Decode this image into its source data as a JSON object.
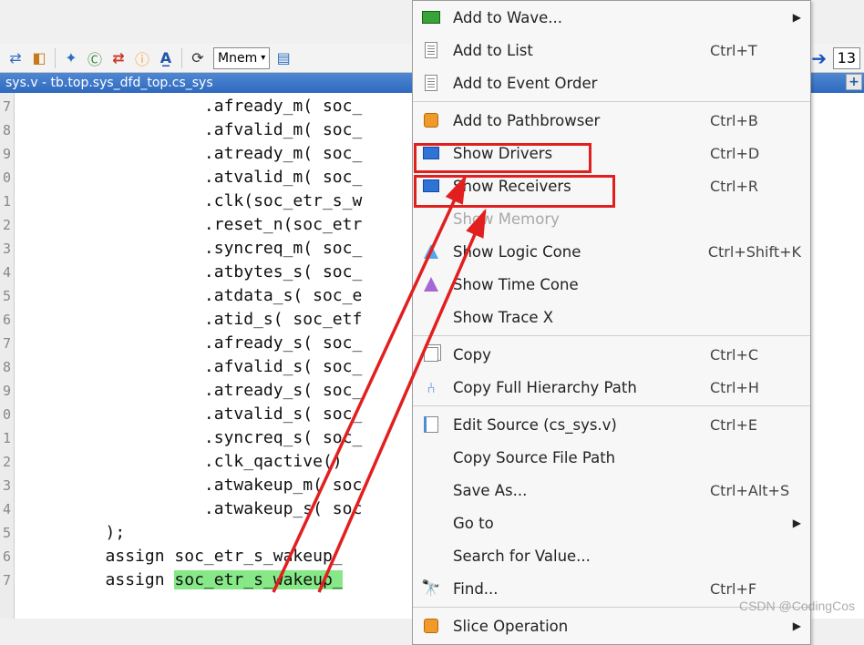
{
  "toolbar": {
    "combo_mode": "Mnem",
    "right_value": "13"
  },
  "titlebar": {
    "path": "sys.v - tb.top.sys_dfd_top.cs_sys"
  },
  "gutter": [
    "7",
    "8",
    "9",
    "0",
    "1",
    "2",
    "3",
    "4",
    "5",
    "6",
    "7",
    "8",
    "9",
    "0",
    "1",
    "2",
    "3",
    "4",
    "5",
    "6",
    "7"
  ],
  "code": {
    "lines": [
      "                   .afready_m( soc_",
      "                   .afvalid_m( soc_",
      "                   .atready_m( soc_",
      "                   .atvalid_m( soc_",
      "                   .clk(soc_etr_s_w",
      "                   .reset_n(soc_etr",
      "                   .syncreq_m( soc_",
      "                   .atbytes_s( soc_",
      "                   .atdata_s( soc_e",
      "                   .atid_s( soc_etf",
      "                   .afready_s( soc_",
      "                   .afvalid_s( soc_",
      "                   .atready_s( soc_",
      "                   .atvalid_s( soc_",
      "                   .syncreq_s( soc_",
      "                   .clk_qactive()",
      "                   .atwakeup_m( soc",
      "                   .atwakeup_s( soc",
      "         );",
      "         assign soc_etr_s_wakeup_",
      "         assign soc_etr_s_wakeup_"
    ],
    "highlighted_line_index": 20,
    "selected_token": "soc_etr_s_wakeup_"
  },
  "menu": {
    "items": [
      {
        "label": "Add to Wave...",
        "icon": "wave-icon",
        "shortcut": "",
        "submenu": true
      },
      {
        "label": "Add to List",
        "icon": "list-icon",
        "shortcut": "Ctrl+T"
      },
      {
        "label": "Add to Event Order",
        "icon": "event-icon",
        "shortcut": ""
      },
      {
        "sep": true
      },
      {
        "label": "Add to Pathbrowser",
        "icon": "path-icon",
        "shortcut": "Ctrl+B"
      },
      {
        "label": "Show Drivers",
        "icon": "drivers-icon",
        "shortcut": "Ctrl+D",
        "boxed": true
      },
      {
        "label": "Show Receivers",
        "icon": "receivers-icon",
        "shortcut": "Ctrl+R",
        "boxed": true
      },
      {
        "label": "Show Memory",
        "icon": "",
        "shortcut": "",
        "disabled": true
      },
      {
        "label": "Show Logic Cone",
        "icon": "logic-cone-icon",
        "shortcut": "Ctrl+Shift+K"
      },
      {
        "label": "Show Time Cone",
        "icon": "time-cone-icon",
        "shortcut": ""
      },
      {
        "label": "Show Trace X",
        "icon": "",
        "shortcut": ""
      },
      {
        "sep": true
      },
      {
        "label": "Copy",
        "icon": "copy-icon",
        "shortcut": "Ctrl+C"
      },
      {
        "label": "Copy Full Hierarchy Path",
        "icon": "hierarchy-icon",
        "shortcut": "Ctrl+H"
      },
      {
        "sep": true
      },
      {
        "label": "Edit Source (cs_sys.v)",
        "icon": "edit-icon",
        "shortcut": "Ctrl+E"
      },
      {
        "label": "Copy Source File Path",
        "icon": "",
        "shortcut": ""
      },
      {
        "label": "Save As...",
        "icon": "",
        "shortcut": "Ctrl+Alt+S"
      },
      {
        "label": "Go to",
        "icon": "",
        "shortcut": "",
        "submenu": true
      },
      {
        "label": "Search for Value...",
        "icon": "",
        "shortcut": ""
      },
      {
        "label": "Find...",
        "icon": "find-icon",
        "shortcut": "Ctrl+F"
      },
      {
        "sep": true
      },
      {
        "label": "Slice Operation",
        "icon": "slice-icon",
        "shortcut": "",
        "submenu": true
      }
    ]
  },
  "watermark": "CSDN @CodingCos"
}
